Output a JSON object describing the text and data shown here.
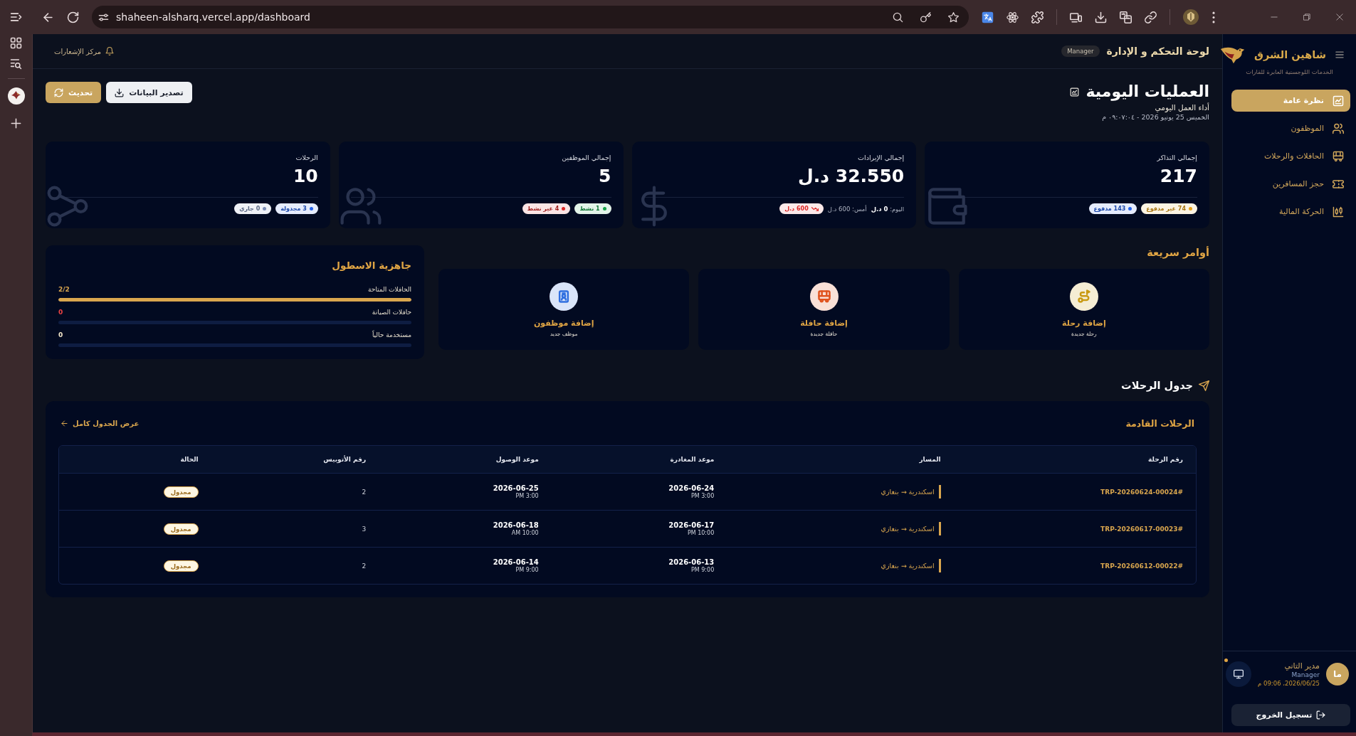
{
  "browser": {
    "url": "shaheen-alsharq.vercel.app/dashboard"
  },
  "sidebar": {
    "brand": "شاهين الشرق",
    "tagline": "الخدمات اللوجستية العابرة للقارات",
    "items": [
      {
        "label": "نظرة عامة",
        "selected": true
      },
      {
        "label": "الموظفون",
        "selected": false
      },
      {
        "label": "الحافلات والرحلات",
        "selected": false
      },
      {
        "label": "حجز المسافرين",
        "selected": false
      },
      {
        "label": "الحركة المالية",
        "selected": false
      }
    ],
    "user": {
      "initials": "ما",
      "name": "مدير التاني",
      "role": "Manager",
      "last_login": "2026/06/25، 09:06 م"
    },
    "logout": "تسجيل الخروج"
  },
  "topbar": {
    "title": "لوحة التحكم و الإدارة",
    "role": "Manager",
    "notifications": "مركز الإشعارات"
  },
  "header": {
    "title": "العمليات اليومية",
    "subtitle": "أداء العمل اليومي",
    "date": "الخميس 25 يونيو 2026 - ٠٩:٠٧:٠٤ م",
    "actions": [
      {
        "label": "تصدير البيانات",
        "kind": "secondary"
      },
      {
        "label": "تحديث",
        "kind": "primary"
      }
    ]
  },
  "stats": [
    {
      "kind": "badges",
      "label": "إجمالي التذاكر",
      "value": "217",
      "badges": [
        {
          "label": "74 غير مدفوع",
          "color": "#e8a317"
        },
        {
          "label": "143 مدفوع",
          "color": "#2563eb"
        }
      ]
    },
    {
      "kind": "revenue",
      "label": "إجمالي الإيرادات",
      "value": "32.550 د.ل",
      "today": "اليوم: **0 د.ل**",
      "yesterday": "أمس: 600 د.ل",
      "trend": {
        "label": "600 د.ل",
        "color": "#dc2626"
      }
    },
    {
      "kind": "badges",
      "label": "إجمالي الموظفين",
      "value": "5",
      "badges": [
        {
          "label": "1 نشط",
          "color": "#16a34a"
        },
        {
          "label": "4 غير نشط",
          "color": "#dc2626"
        }
      ]
    },
    {
      "kind": "badges",
      "label": "الرحلات",
      "value": "10",
      "badges": [
        {
          "label": "3 مجدولة",
          "color": "#2563eb"
        },
        {
          "label": "0 جاري",
          "color": "#7c8db5"
        }
      ]
    }
  ],
  "quick_actions": {
    "title": "أوامر سريعة",
    "items": [
      {
        "label": "إضافة رحلة",
        "sublabel": "رحلة جديدة",
        "color": "#c99a12"
      },
      {
        "label": "إضافة حافلة",
        "sublabel": "حافلة جديدة",
        "color": "#e0531f"
      },
      {
        "label": "إضافة موظفون",
        "sublabel": "موظف جديد",
        "color": "#2f6fe0"
      }
    ]
  },
  "fleet": {
    "title": "جاهزية الاسطول",
    "rows": [
      {
        "label": "الحافلات المتاحة",
        "value": "2/2",
        "level": 1,
        "color": "#d9a64e"
      },
      {
        "label": "حافلات الصيانة",
        "value": "0",
        "level": 0,
        "color": "#ef4444"
      },
      {
        "label": "مستخدمة حالياً",
        "value": "0",
        "level": 0,
        "color": "#f3e7c9"
      }
    ]
  },
  "schedule": {
    "title": "جدول الرحلات",
    "card_title": "الرحلات القادمة",
    "link": "عرض الجدول كامل",
    "columns": [
      "رقم الرحلة",
      "المسار",
      "موعد المغادرة",
      "موعد الوصول",
      "رقم الأتوبيس",
      "الحالة"
    ],
    "rows": [
      {
        "trip": "#TRP-20260624-00024",
        "route": "اسكندرية → بنغازي",
        "departure_date": "2026-06-24",
        "departure_time": "3:00 PM",
        "arrival_date": "2026-06-25",
        "arrival_time": "3:00 PM",
        "bus": "2",
        "status": "مجدول"
      },
      {
        "trip": "#TRP-20260617-00023",
        "route": "اسكندرية → بنغازي",
        "departure_date": "2026-06-17",
        "departure_time": "10:00 PM",
        "arrival_date": "2026-06-18",
        "arrival_time": "10:00 AM",
        "bus": "3",
        "status": "مجدول"
      },
      {
        "trip": "#TRP-20260612-00022",
        "route": "اسكندرية → بنغازي",
        "departure_date": "2026-06-13",
        "departure_time": "9:00 PM",
        "arrival_date": "2026-06-14",
        "arrival_time": "9:00 PM",
        "bus": "2",
        "status": "مجدول"
      }
    ]
  }
}
